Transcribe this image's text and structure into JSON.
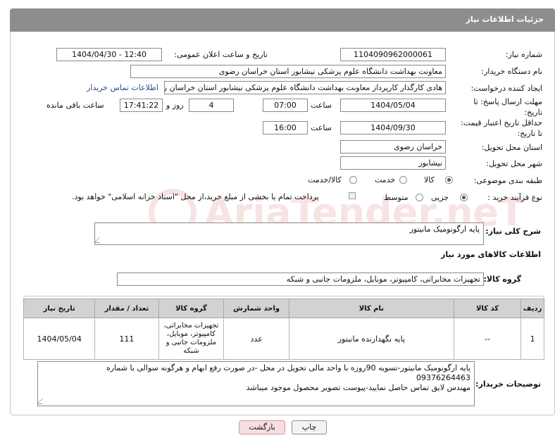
{
  "header": {
    "title": "جزئیات اطلاعات نیاز"
  },
  "form": {
    "need_number_label": "شماره نیاز:",
    "need_number": "1104090962000061",
    "announce_label": "تاریخ و ساعت اعلان عمومی:",
    "announce_value": "1404/04/30 - 12:40",
    "buyer_org_label": "نام دستگاه خریدار:",
    "buyer_org": "معاونت بهداشت دانشگاه علوم پزشکی نیشابور استان خراسان رضوی",
    "requester_label": "ایجاد کننده درخواست:",
    "requester": "هادی کارگذار کارپرداز معاونت بهداشت دانشگاه علوم پزشکی نیشابور استان خراسان رضوی",
    "contact_link": "اطلاعات تماس خریدار",
    "deadline_label_1": "مهلت ارسال پاسخ: تا",
    "deadline_label_2": "تاریخ:",
    "deadline_date": "1404/05/04",
    "time_label": "ساعت",
    "deadline_time": "07:00",
    "days_value": "4",
    "days_label": "روز و",
    "remaining_time": "17:41:22",
    "remaining_label": "ساعت باقی مانده",
    "min_price_label_1": "حداقل تاریخ اعتبار قیمت:",
    "min_price_label_2": "تا تاریخ:",
    "price_date": "1404/09/30",
    "price_time": "16:00",
    "province_label": "استان محل تحویل:",
    "province": "خراسان رضوی",
    "city_label": "شهر محل تحویل:",
    "city": "نیشابور",
    "category_label": "طبقه بندی موضوعی:",
    "category_options": [
      "کالا",
      "خدمت",
      "کالا/خدمت"
    ],
    "process_label": "نوع فرآیند خرید :",
    "process_options": [
      "جزیی",
      "متوسط"
    ],
    "payment_note": "پرداخت تمام یا بخشی از مبلغ خرید،از محل \"اسناد خزانه اسلامی\" خواهد بود."
  },
  "summary": {
    "label": "شرح کلی نیاز:",
    "value": "پایه ارگونومیک مانیتور"
  },
  "goods_info": {
    "title": "اطلاعات کالاهای مورد نیاز"
  },
  "goods_group": {
    "label": "گروه کالا:",
    "value": "تجهیزات مخابراتی، کامپیوتر، موبایل، ملزومات جانبی و شبکه"
  },
  "table": {
    "headers": [
      "ردیف",
      "کد کالا",
      "نام کالا",
      "واحد شمارش",
      "گروه کالا",
      "تعداد / مقدار",
      "تاریخ نیاز"
    ],
    "rows": [
      [
        "1",
        "--",
        "پایه نگهدارنده مانیتور",
        "عدد",
        "تجهیزات مخابراتی، کامپیوتر، موبایل، ملزومات جانبی و شبکه",
        "111",
        "1404/05/04"
      ]
    ]
  },
  "buyer_notes": {
    "label": "توضیحات خریدار:",
    "line1": "پایه ارگونومیک مانیتور-تسویه 90روزه با واحد مالی تحویل در محل -در صورت رفع ابهام و هرگونه سوالی با شماره",
    "line2": "09376264463",
    "line3": "مهندس لایق تماس حاصل نمایید-پیوست تصویر محصول موجود میباشد"
  },
  "buttons": {
    "print": "چاپ",
    "back": "بازگشت"
  },
  "watermark": {
    "text": "AriaTender.neT"
  }
}
